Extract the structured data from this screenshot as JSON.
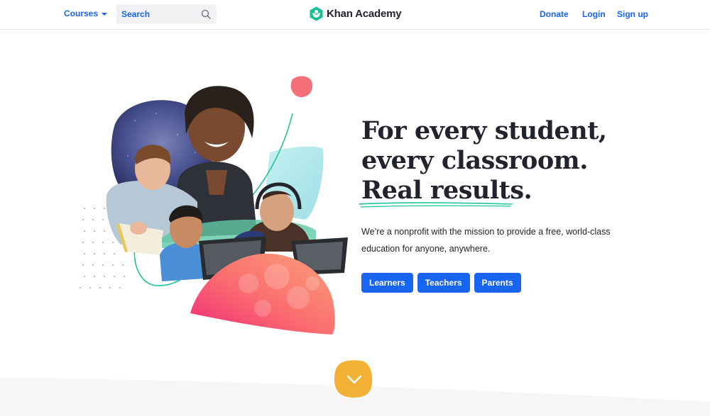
{
  "header": {
    "courses_label": "Courses",
    "search_placeholder": "Search",
    "logo_text": "Khan Academy",
    "nav": {
      "donate": "Donate",
      "login": "Login",
      "signup": "Sign up"
    }
  },
  "hero": {
    "headline_lines": [
      "For every student,",
      "every classroom.",
      "Real results."
    ],
    "subtext": "We’re a nonprofit with the mission to provide a free, world-class education for anyone, anywhere.",
    "buttons": {
      "learners": "Learners",
      "teachers": "Teachers",
      "parents": "Parents"
    },
    "image_description": "Collage of smiling students using laptops and notebooks over colorful abstract shapes"
  },
  "colors": {
    "primary_blue": "#1865f2",
    "brand_green": "#14bf96",
    "text_dark": "#21242c",
    "scroll_button": "#f2b135",
    "band_gray": "#f7f6f5"
  },
  "icons": {
    "search": "search-icon",
    "caret": "caret-down-icon",
    "logo": "khan-academy-logo-icon",
    "scroll": "chevron-down-icon"
  }
}
